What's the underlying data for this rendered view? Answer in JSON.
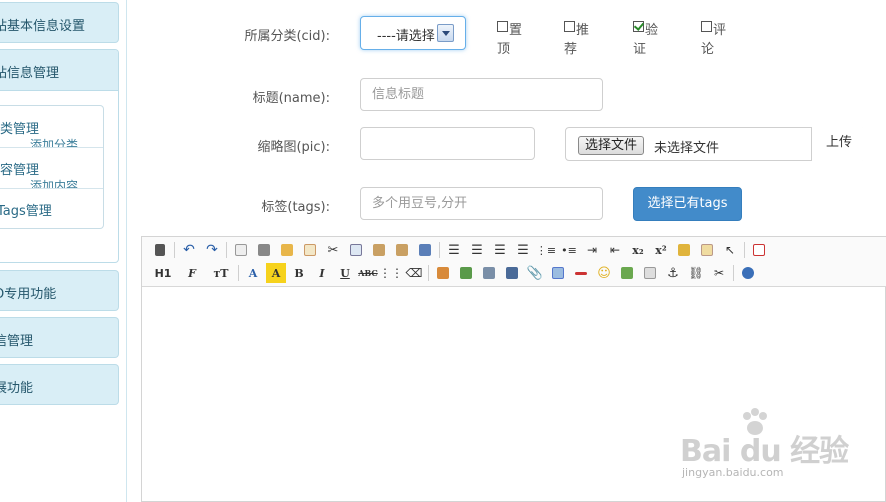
{
  "sidebar": {
    "menu1": "站基本信息设置",
    "menu2": "站信息管理",
    "sub1_main": "分类管理",
    "sub1_minor": "添加分类",
    "sub2_main": "内容管理",
    "sub2_minor": "添加内容",
    "sub3_main": "Tags管理",
    "menu3": "O专用功能",
    "menu4": "信管理",
    "menu5": "展功能"
  },
  "form": {
    "cid_label": "所属分类(cid):",
    "cid_select": "----请选择",
    "options": {
      "top": {
        "line1": "置",
        "line2": "顶",
        "checked": false
      },
      "recommend": {
        "line1": "推",
        "line2": "荐",
        "checked": false
      },
      "verify": {
        "line1": "验",
        "line2": "证",
        "checked": true
      },
      "comment": {
        "line1": "评",
        "line2": "论",
        "checked": false
      }
    },
    "name_label": "标题(name):",
    "name_placeholder": "信息标题",
    "pic_label": "缩略图(pic):",
    "file_button": "选择文件",
    "file_status": "未选择文件",
    "upload_button": "上传",
    "tags_label": "标签(tags):",
    "tags_placeholder": "多个用豆号,分开",
    "tags_button": "选择已有tags"
  },
  "editor": {
    "toolbar_row1": [
      "source-icon",
      "undo-icon",
      "redo-icon",
      "preview-icon",
      "print-icon",
      "template-icon",
      "code-icon",
      "cut-icon",
      "copy-icon",
      "paste-icon",
      "paste-plain-icon",
      "paste-word-icon",
      "align-left-icon",
      "align-center-icon",
      "align-right-icon",
      "align-justify-icon",
      "ordered-list-icon",
      "unordered-list-icon",
      "indent-icon",
      "outdent-icon",
      "subscript-icon",
      "superscript-icon",
      "clear-format-icon",
      "select-all-icon",
      "quick-format-icon",
      "fullscreen-icon"
    ],
    "subscript_text": "x₂",
    "superscript_text": "x²",
    "heading_text": "H1",
    "font_text": "F",
    "size_text": "тT",
    "color_text": "A",
    "hilite_text": "A",
    "bold_text": "B",
    "italic_text": "I",
    "underline_text": "U",
    "strike_text": "ABC"
  },
  "watermark": {
    "logo": "Bai du 经验",
    "url": "jingyan.baidu.com"
  },
  "colors": {
    "sidebar_bg": "#d9eef6",
    "primary": "#428bca",
    "focus": "#66afe9"
  }
}
